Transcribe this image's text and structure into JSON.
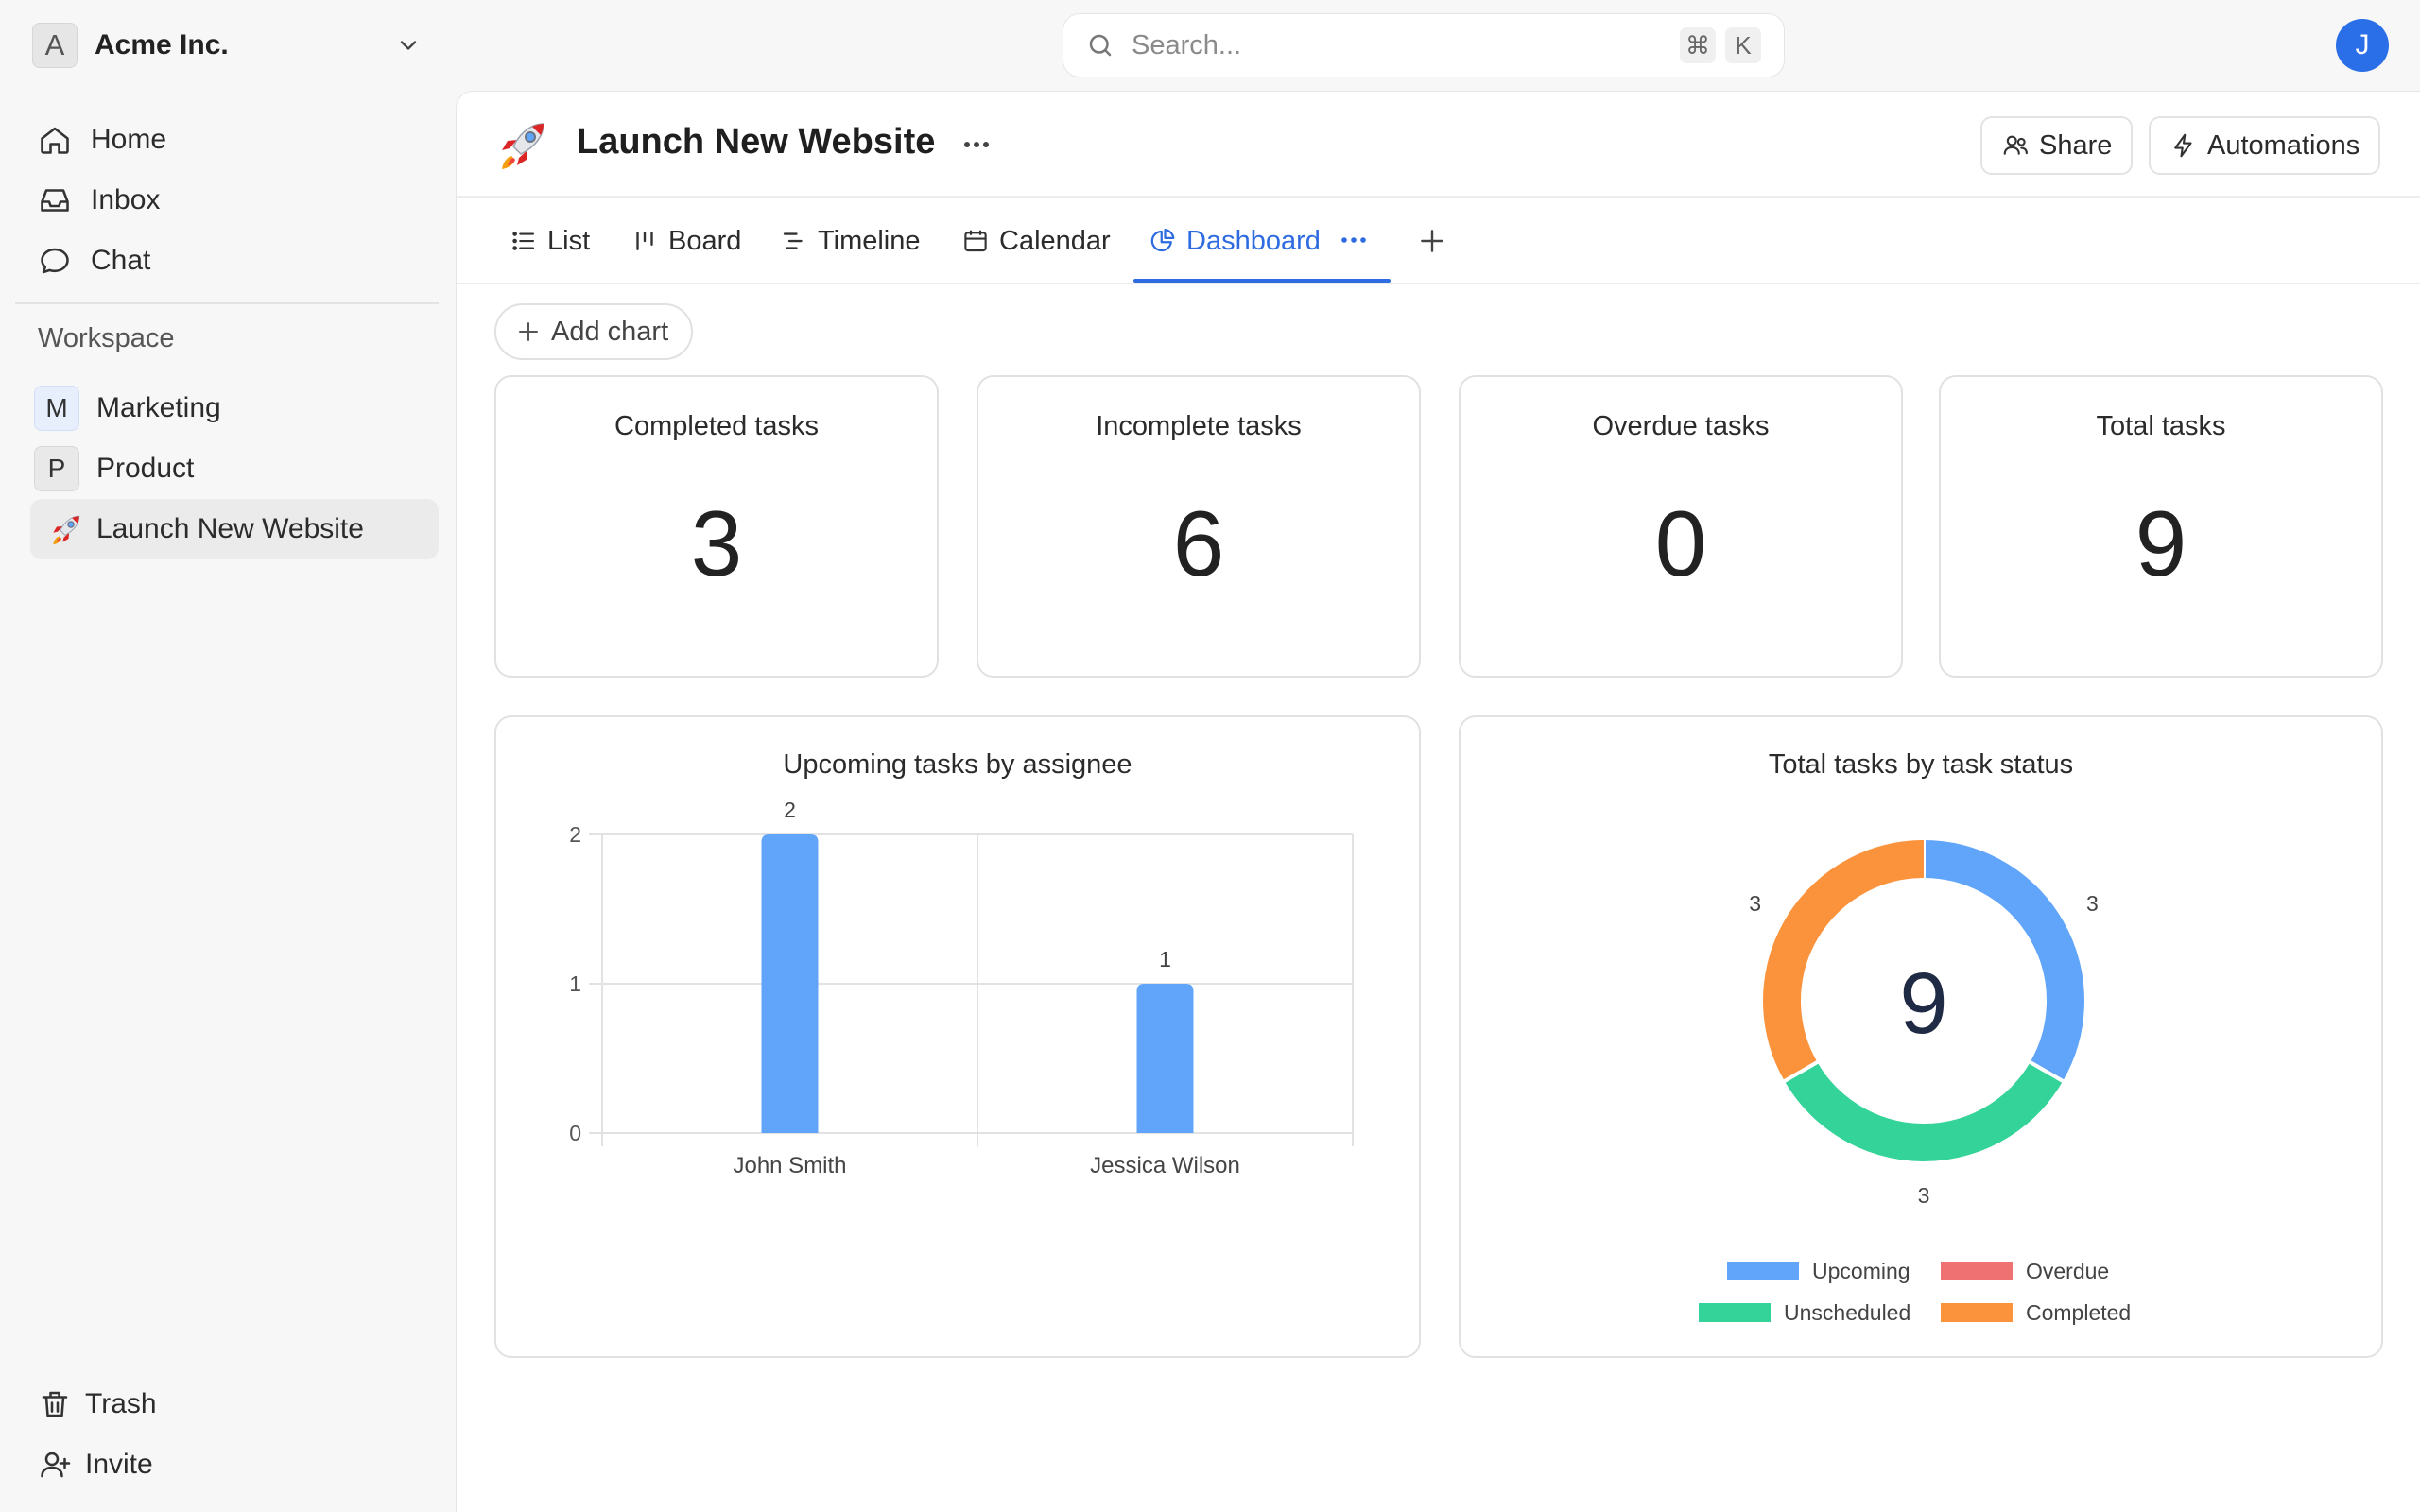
{
  "workspace": {
    "initial": "A",
    "name": "Acme Inc."
  },
  "search": {
    "placeholder": "Search...",
    "shortcut_cmd": "⌘",
    "shortcut_key": "K"
  },
  "user": {
    "initial": "J"
  },
  "sidebar": {
    "nav": [
      {
        "label": "Home",
        "icon": "home-icon"
      },
      {
        "label": "Inbox",
        "icon": "inbox-icon"
      },
      {
        "label": "Chat",
        "icon": "chat-icon"
      }
    ],
    "section_title": "Workspace",
    "projects": [
      {
        "initial": "M",
        "label": "Marketing"
      },
      {
        "initial": "P",
        "label": "Product"
      },
      {
        "label": "Launch New Website",
        "icon": "rocket-icon",
        "active": true
      }
    ],
    "footer": [
      {
        "label": "Trash",
        "icon": "trash-icon"
      },
      {
        "label": "Invite",
        "icon": "invite-user-icon"
      }
    ]
  },
  "page": {
    "title": "Launch New Website",
    "share_label": "Share",
    "automations_label": "Automations"
  },
  "tabs": [
    {
      "label": "List",
      "icon": "list-icon"
    },
    {
      "label": "Board",
      "icon": "board-icon"
    },
    {
      "label": "Timeline",
      "icon": "timeline-icon"
    },
    {
      "label": "Calendar",
      "icon": "calendar-icon"
    },
    {
      "label": "Dashboard",
      "icon": "pie-chart-icon",
      "active": true
    }
  ],
  "add_chart_label": "Add chart",
  "stats": [
    {
      "title": "Completed tasks",
      "value": "3"
    },
    {
      "title": "Incomplete tasks",
      "value": "6"
    },
    {
      "title": "Overdue tasks",
      "value": "0"
    },
    {
      "title": "Total tasks",
      "value": "9"
    }
  ],
  "colors": {
    "accent": "#2f6be0",
    "bar": "#60a5fa",
    "upcoming": "#60a5fa",
    "overdue": "#f07171",
    "unscheduled": "#34d399",
    "completed": "#fb923c"
  },
  "chart_data": [
    {
      "type": "bar",
      "title": "Upcoming tasks by assignee",
      "categories": [
        "John Smith",
        "Jessica Wilson"
      ],
      "values": [
        2,
        1
      ],
      "ylim": [
        0,
        2
      ],
      "yticks": [
        "0",
        "1",
        "2"
      ],
      "grid": true
    },
    {
      "type": "pie",
      "title": "Total tasks by task status",
      "center_value": "9",
      "slices": [
        {
          "name": "Upcoming",
          "value": 3
        },
        {
          "name": "Overdue",
          "value": 0
        },
        {
          "name": "Unscheduled",
          "value": 3
        },
        {
          "name": "Completed",
          "value": 3
        }
      ],
      "legend": "bottom"
    }
  ]
}
